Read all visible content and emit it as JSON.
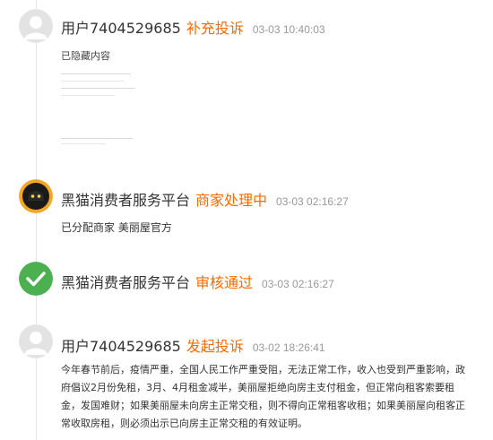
{
  "entries": [
    {
      "avatar": "default-user-avatar-icon",
      "name": "用户7404529685",
      "status": "补充投诉",
      "time": "03-03 10:40:03",
      "content": "已隐藏内容"
    },
    {
      "avatar": "black-cat-logo-icon",
      "name": "黑猫消费者服务平台",
      "status": "商家处理中",
      "time": "03-03 02:16:27",
      "content": "已分配商家 美丽屋官方"
    },
    {
      "avatar": "green-check-icon",
      "name": "黑猫消费者服务平台",
      "status": "审核通过",
      "time": "03-03 02:16:27"
    },
    {
      "avatar": "default-user-avatar-icon",
      "name": "用户7404529685",
      "status": "发起投诉",
      "time": "03-02 18:26:41",
      "content": "今年春节前后，疫情严重，全国人民工作严重受阻，无法正常工作，收入也受到严重影响，政府倡议2月份免租，3月、4月租金减半，美丽屋拒绝向房主支付租金，但正常向租客索要租金，发国难财；如果美丽屋未向房主正常交租，则不得向正常租客收租；如果美丽屋向租客正常收取房租，则必须出示已向房主正常交租的有效证明。"
    }
  ],
  "colors": {
    "status": "#ff6a00",
    "check": "#4caf50",
    "avatar_bg": "#e3e3e3",
    "cat_ring": "#f5a623"
  }
}
